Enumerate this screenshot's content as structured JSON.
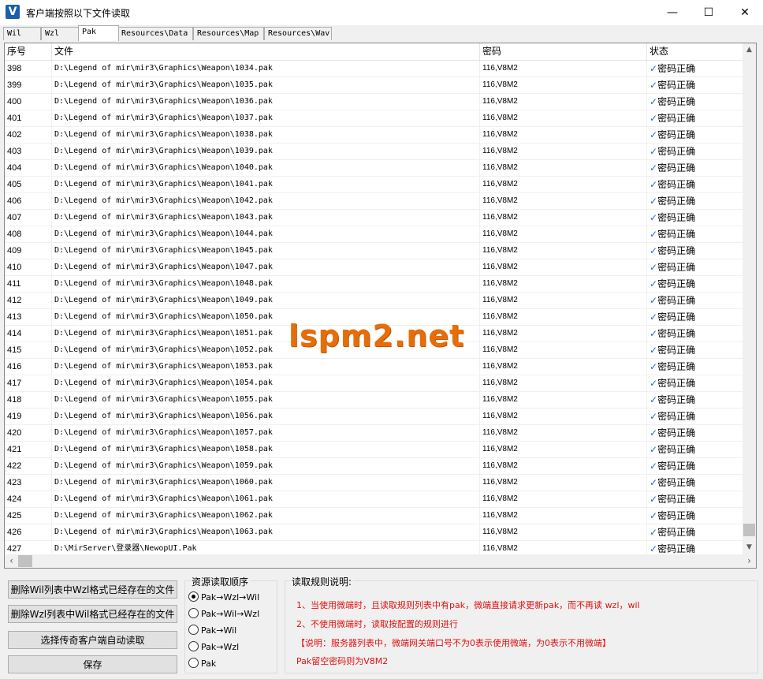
{
  "window": {
    "title": "客户端按照以下文件读取",
    "min": "—",
    "max": "☐",
    "close": "✕",
    "icon": "V"
  },
  "tabs": [
    "Wil",
    "Wzl",
    "Pak",
    "Resources\\Data",
    "Resources\\Map",
    "Resources\\Wav"
  ],
  "active_tab": "Pak",
  "table": {
    "headers": [
      "序号",
      "文件",
      "密码",
      "状态"
    ],
    "rows": [
      {
        "n": "398",
        "file": "D:\\Legend of mir\\mir3\\Graphics\\Weapon\\1034.pak",
        "pw": "116,V8M2",
        "st": "密码正确"
      },
      {
        "n": "399",
        "file": "D:\\Legend of mir\\mir3\\Graphics\\Weapon\\1035.pak",
        "pw": "116,V8M2",
        "st": "密码正确"
      },
      {
        "n": "400",
        "file": "D:\\Legend of mir\\mir3\\Graphics\\Weapon\\1036.pak",
        "pw": "116,V8M2",
        "st": "密码正确"
      },
      {
        "n": "401",
        "file": "D:\\Legend of mir\\mir3\\Graphics\\Weapon\\1037.pak",
        "pw": "116,V8M2",
        "st": "密码正确"
      },
      {
        "n": "402",
        "file": "D:\\Legend of mir\\mir3\\Graphics\\Weapon\\1038.pak",
        "pw": "116,V8M2",
        "st": "密码正确"
      },
      {
        "n": "403",
        "file": "D:\\Legend of mir\\mir3\\Graphics\\Weapon\\1039.pak",
        "pw": "116,V8M2",
        "st": "密码正确"
      },
      {
        "n": "404",
        "file": "D:\\Legend of mir\\mir3\\Graphics\\Weapon\\1040.pak",
        "pw": "116,V8M2",
        "st": "密码正确"
      },
      {
        "n": "405",
        "file": "D:\\Legend of mir\\mir3\\Graphics\\Weapon\\1041.pak",
        "pw": "116,V8M2",
        "st": "密码正确"
      },
      {
        "n": "406",
        "file": "D:\\Legend of mir\\mir3\\Graphics\\Weapon\\1042.pak",
        "pw": "116,V8M2",
        "st": "密码正确"
      },
      {
        "n": "407",
        "file": "D:\\Legend of mir\\mir3\\Graphics\\Weapon\\1043.pak",
        "pw": "116,V8M2",
        "st": "密码正确"
      },
      {
        "n": "408",
        "file": "D:\\Legend of mir\\mir3\\Graphics\\Weapon\\1044.pak",
        "pw": "116,V8M2",
        "st": "密码正确"
      },
      {
        "n": "409",
        "file": "D:\\Legend of mir\\mir3\\Graphics\\Weapon\\1045.pak",
        "pw": "116,V8M2",
        "st": "密码正确"
      },
      {
        "n": "410",
        "file": "D:\\Legend of mir\\mir3\\Graphics\\Weapon\\1047.pak",
        "pw": "116,V8M2",
        "st": "密码正确"
      },
      {
        "n": "411",
        "file": "D:\\Legend of mir\\mir3\\Graphics\\Weapon\\1048.pak",
        "pw": "116,V8M2",
        "st": "密码正确"
      },
      {
        "n": "412",
        "file": "D:\\Legend of mir\\mir3\\Graphics\\Weapon\\1049.pak",
        "pw": "116,V8M2",
        "st": "密码正确"
      },
      {
        "n": "413",
        "file": "D:\\Legend of mir\\mir3\\Graphics\\Weapon\\1050.pak",
        "pw": "116,V8M2",
        "st": "密码正确"
      },
      {
        "n": "414",
        "file": "D:\\Legend of mir\\mir3\\Graphics\\Weapon\\1051.pak",
        "pw": "116,V8M2",
        "st": "密码正确"
      },
      {
        "n": "415",
        "file": "D:\\Legend of mir\\mir3\\Graphics\\Weapon\\1052.pak",
        "pw": "116,V8M2",
        "st": "密码正确"
      },
      {
        "n": "416",
        "file": "D:\\Legend of mir\\mir3\\Graphics\\Weapon\\1053.pak",
        "pw": "116,V8M2",
        "st": "密码正确"
      },
      {
        "n": "417",
        "file": "D:\\Legend of mir\\mir3\\Graphics\\Weapon\\1054.pak",
        "pw": "116,V8M2",
        "st": "密码正确"
      },
      {
        "n": "418",
        "file": "D:\\Legend of mir\\mir3\\Graphics\\Weapon\\1055.pak",
        "pw": "116,V8M2",
        "st": "密码正确"
      },
      {
        "n": "419",
        "file": "D:\\Legend of mir\\mir3\\Graphics\\Weapon\\1056.pak",
        "pw": "116,V8M2",
        "st": "密码正确"
      },
      {
        "n": "420",
        "file": "D:\\Legend of mir\\mir3\\Graphics\\Weapon\\1057.pak",
        "pw": "116,V8M2",
        "st": "密码正确"
      },
      {
        "n": "421",
        "file": "D:\\Legend of mir\\mir3\\Graphics\\Weapon\\1058.pak",
        "pw": "116,V8M2",
        "st": "密码正确"
      },
      {
        "n": "422",
        "file": "D:\\Legend of mir\\mir3\\Graphics\\Weapon\\1059.pak",
        "pw": "116,V8M2",
        "st": "密码正确"
      },
      {
        "n": "423",
        "file": "D:\\Legend of mir\\mir3\\Graphics\\Weapon\\1060.pak",
        "pw": "116,V8M2",
        "st": "密码正确"
      },
      {
        "n": "424",
        "file": "D:\\Legend of mir\\mir3\\Graphics\\Weapon\\1061.pak",
        "pw": "116,V8M2",
        "st": "密码正确"
      },
      {
        "n": "425",
        "file": "D:\\Legend of mir\\mir3\\Graphics\\Weapon\\1062.pak",
        "pw": "116,V8M2",
        "st": "密码正确"
      },
      {
        "n": "426",
        "file": "D:\\Legend of mir\\mir3\\Graphics\\Weapon\\1063.pak",
        "pw": "116,V8M2",
        "st": "密码正确"
      },
      {
        "n": "427",
        "file": "D:\\MirServer\\登录器\\NewopUI.Pak",
        "pw": "116,V8M2",
        "st": "密码正确"
      }
    ],
    "status_check_glyph": "✓"
  },
  "watermark": "lspm2.net",
  "buttons": {
    "del_wil": "删除Wil列表中Wzl格式已经存在的文件",
    "del_wzl": "删除Wzl列表中Wil格式已经存在的文件",
    "select_client": "选择传奇客户端自动读取",
    "save": "保存"
  },
  "order_group": {
    "title": "资源读取顺序",
    "options": [
      "Pak→Wzl→Wil",
      "Pak→Wil→Wzl",
      "Pak→Wil",
      "Pak→Wzl",
      "Pak"
    ],
    "selected_index": 0
  },
  "rules_group": {
    "title": "读取规则说明:",
    "lines": [
      "1、当使用微端时，且读取规则列表中有pak，微端直接请求更新pak，而不再读 wzl，wil",
      "2、不使用微端时，读取按配置的规则进行",
      "【说明：服务器列表中，微端网关端口号不为0表示使用微端，为0表示不用微端】",
      "Pak留空密码则为V8M2"
    ],
    "color": "#e01010"
  }
}
